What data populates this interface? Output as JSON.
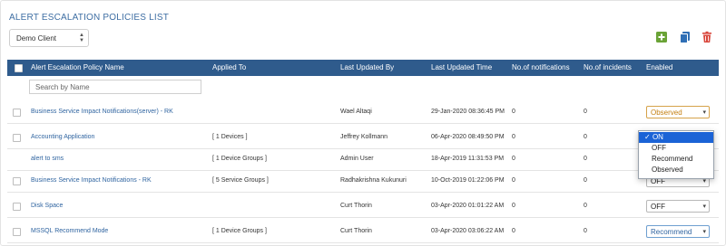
{
  "page": {
    "title": "ALERT ESCALATION POLICIES  LIST"
  },
  "client_select": {
    "value": "Demo Client"
  },
  "toolbar": {
    "add_icon": "plus-square-icon",
    "copy_icon": "copy-icon",
    "delete_icon": "trash-icon",
    "colors": {
      "add": "#6aa336",
      "copy": "#2f6fb5",
      "delete": "#d9473c"
    }
  },
  "table": {
    "headers": [
      "Alert Escalation Policy Name",
      "Applied To",
      "Last Updated By",
      "Last Updated Time",
      "No.of notifications",
      "No.of incidents",
      "Enabled"
    ],
    "search": {
      "placeholder": "Search by Name",
      "value": ""
    },
    "rows": [
      {
        "name": "Business Service Impact Notifications(server) - RK",
        "applied_to": "",
        "updated_by": "Wael Altaqi",
        "updated_time": "29-Jan-2020 08:36:45 PM",
        "notifications": "0",
        "incidents": "0",
        "enabled": "Observed"
      },
      {
        "name": "Accounting Application",
        "applied_to": "[ 1 Devices ]",
        "updated_by": "Jeffrey Kollmann",
        "updated_time": "06-Apr-2020 08:49:50 PM",
        "notifications": "0",
        "incidents": "0",
        "enabled": "ON"
      },
      {
        "name": "alert to sms",
        "applied_to": "[ 1 Device Groups ]",
        "updated_by": "Admin User",
        "updated_time": "18-Apr-2019 11:31:53 PM",
        "notifications": "0",
        "incidents": "0",
        "enabled": ""
      },
      {
        "name": "Business Service Impact Notifications - RK",
        "applied_to": "[ 5 Service Groups ]",
        "updated_by": "Radhakrishna Kukunuri",
        "updated_time": "10-Oct-2019 01:22:06 PM",
        "notifications": "0",
        "incidents": "0",
        "enabled": "OFF"
      },
      {
        "name": "Disk Space",
        "applied_to": "",
        "updated_by": "Curt Thorin",
        "updated_time": "03-Apr-2020 01:01:22 AM",
        "notifications": "0",
        "incidents": "0",
        "enabled": "OFF"
      },
      {
        "name": "MSSQL Recommend Mode",
        "applied_to": "[ 1 Device Groups ]",
        "updated_by": "Curt Thorin",
        "updated_time": "03-Apr-2020 03:06:22 AM",
        "notifications": "0",
        "incidents": "0",
        "enabled": "Recommend"
      }
    ]
  },
  "dropdown": {
    "options": [
      "ON",
      "OFF",
      "Recommend",
      "Observed"
    ],
    "selected": "ON",
    "check_mark": "✓"
  }
}
